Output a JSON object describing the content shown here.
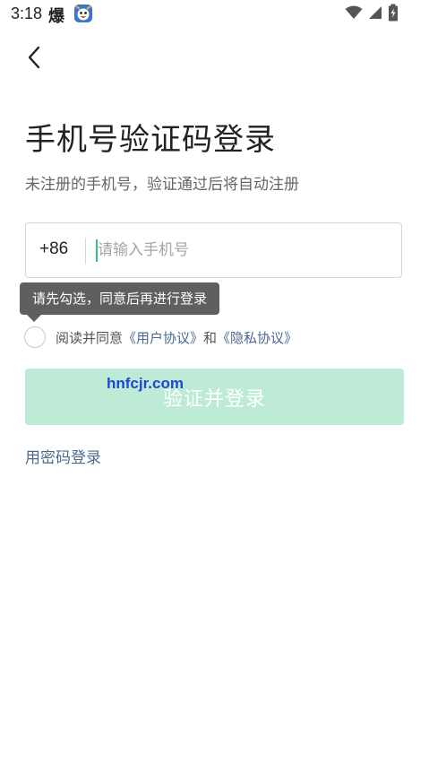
{
  "status_bar": {
    "time": "3:18",
    "app_label": "爆",
    "icons": [
      "app-badge-icon",
      "wifi-icon",
      "cell-signal-icon",
      "battery-charging-icon"
    ]
  },
  "header": {
    "back_icon": "chevron-left-icon"
  },
  "title": "手机号验证码登录",
  "subtitle": "未注册的手机号，验证通过后将自动注册",
  "phone_field": {
    "country_code": "+86",
    "value": "",
    "placeholder": "请输入手机号"
  },
  "tooltip": {
    "text": "请先勾选，同意后再进行登录"
  },
  "agreement": {
    "checked": false,
    "prefix": "阅读并同意",
    "user_agreement": "《用户协议》",
    "conjunction": "和",
    "privacy_policy": "《隐私协议》"
  },
  "submit": {
    "label": "验证并登录"
  },
  "watermark": "hnfcjr.com",
  "password_login": {
    "label": "用密码登录"
  },
  "colors": {
    "accent": "#33c27f",
    "button_disabled": "#bdebd6",
    "link": "#4b6a8e",
    "tooltip_bg": "#5f5f5f"
  }
}
